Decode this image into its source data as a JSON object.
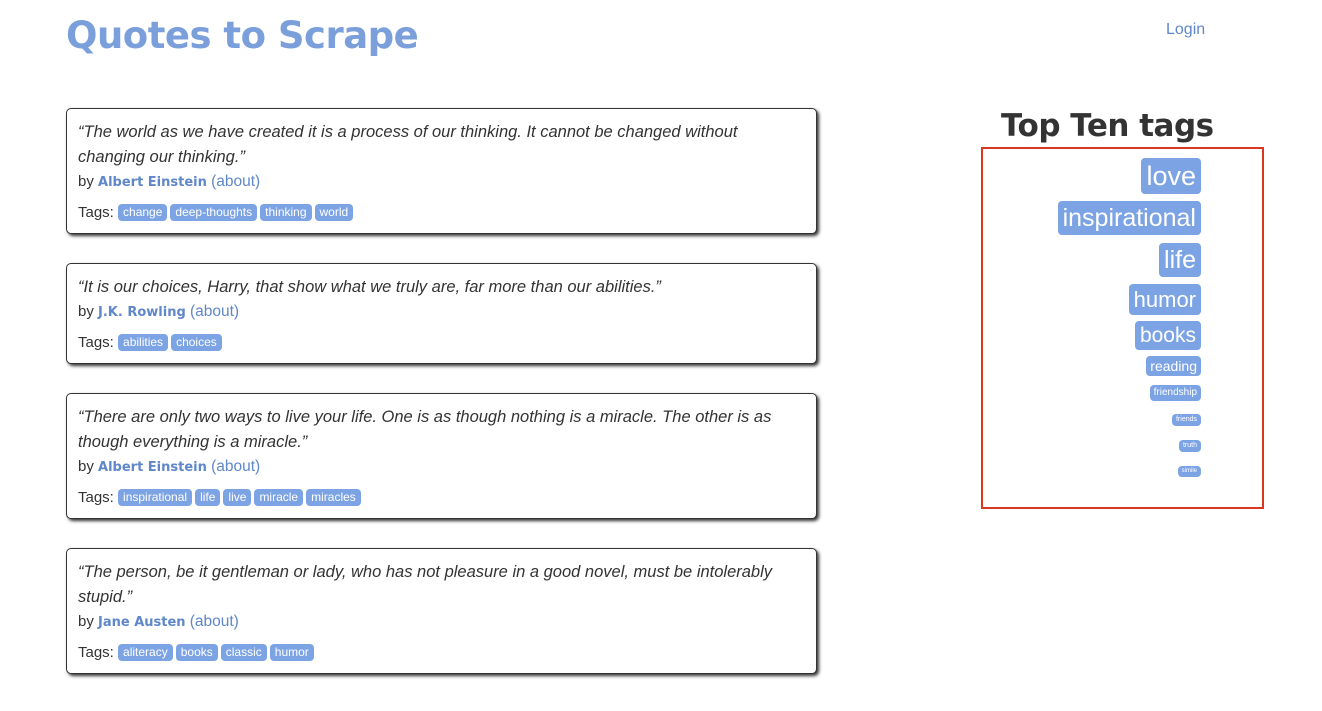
{
  "header": {
    "title": "Quotes to Scrape",
    "login_label": "Login"
  },
  "quotes": [
    {
      "text": "“The world as we have created it is a process of our thinking. It cannot be changed without changing our thinking.”",
      "by_label": "by",
      "author": "Albert Einstein",
      "about_label": "(about)",
      "tags_label": "Tags:",
      "tags": [
        "change",
        "deep-thoughts",
        "thinking",
        "world"
      ]
    },
    {
      "text": "“It is our choices, Harry, that show what we truly are, far more than our abilities.”",
      "by_label": "by",
      "author": "J.K. Rowling",
      "about_label": "(about)",
      "tags_label": "Tags:",
      "tags": [
        "abilities",
        "choices"
      ]
    },
    {
      "text": "“There are only two ways to live your life. One is as though nothing is a miracle. The other is as though everything is a miracle.”",
      "by_label": "by",
      "author": "Albert Einstein",
      "about_label": "(about)",
      "tags_label": "Tags:",
      "tags": [
        "inspirational",
        "life",
        "live",
        "miracle",
        "miracles"
      ]
    },
    {
      "text": "“The person, be it gentleman or lady, who has not pleasure in a good novel, must be intolerably stupid.”",
      "by_label": "by",
      "author": "Jane Austen",
      "about_label": "(about)",
      "tags_label": "Tags:",
      "tags": [
        "aliteracy",
        "books",
        "classic",
        "humor"
      ]
    }
  ],
  "sidebar": {
    "heading": "Top Ten tags",
    "tags": [
      "love",
      "inspirational",
      "life",
      "humor",
      "books",
      "reading",
      "friendship",
      "friends",
      "truth",
      "simile"
    ]
  },
  "colors": {
    "brand": "#7b9fdb",
    "tag_background": "#7ca3e4",
    "highlight_border": "#d9371f"
  }
}
